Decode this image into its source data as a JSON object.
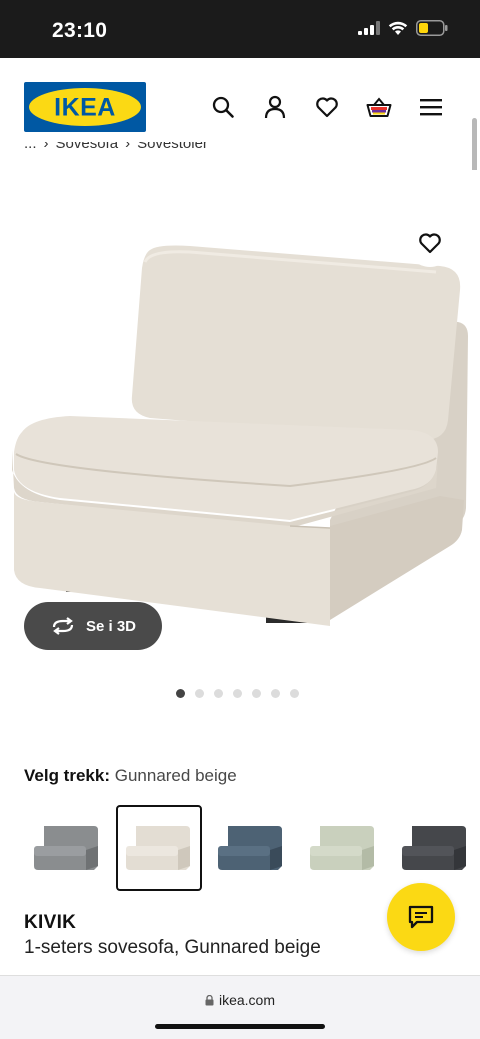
{
  "status_bar": {
    "time": "23:10"
  },
  "header": {
    "logo_text": "IKEA",
    "icons": [
      "search-icon",
      "account-icon",
      "heart-icon",
      "basket-icon",
      "menu-icon"
    ]
  },
  "breadcrumb": {
    "items": [
      "...",
      "Sovesofa",
      "Sovestoler"
    ]
  },
  "gallery": {
    "view_3d_label": "Se i 3D",
    "dot_count": 7,
    "active_dot": 0
  },
  "cover": {
    "label": "Velg trekk:",
    "value": "Gunnared beige",
    "swatches": [
      {
        "name": "grey",
        "color": "#8a8d8f",
        "selected": false
      },
      {
        "name": "beige",
        "color": "#e3ddd3",
        "selected": true
      },
      {
        "name": "blue",
        "color": "#4d6274",
        "selected": false
      },
      {
        "name": "light green",
        "color": "#c9d0bd",
        "selected": false
      },
      {
        "name": "dark grey",
        "color": "#45474b",
        "selected": false
      }
    ]
  },
  "product": {
    "name": "KIVIK",
    "description": "1-seters sovesofa, Gunnared beige"
  },
  "browser": {
    "url": "ikea.com"
  },
  "colors": {
    "ikea_blue": "#0058a3",
    "ikea_yellow": "#fbd914"
  }
}
